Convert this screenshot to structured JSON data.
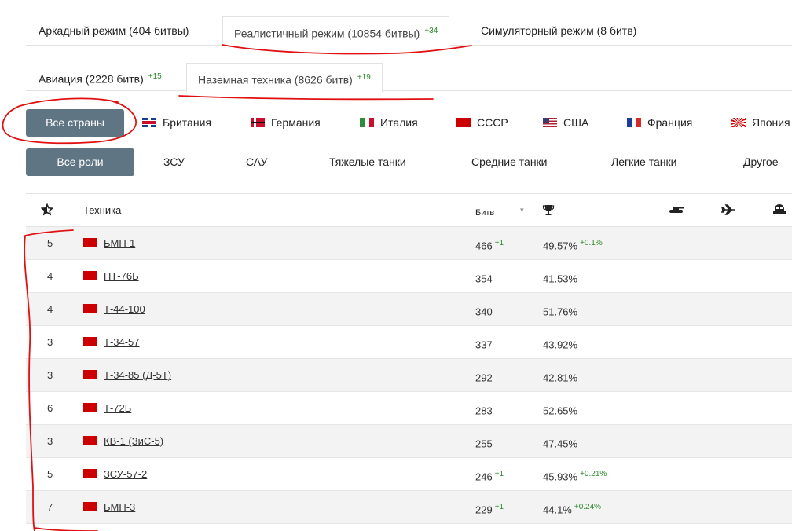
{
  "mode_tabs": [
    {
      "label": "Аркадный режим (404 битвы)",
      "delta": ""
    },
    {
      "label": "Реалистичный режим (10854 битвы)",
      "delta": "+34"
    },
    {
      "label": "Симуляторный режим (8 битв)",
      "delta": ""
    }
  ],
  "vehicle_tabs": [
    {
      "label": "Авиация (2228 битв)",
      "delta": "+15"
    },
    {
      "label": "Наземная техника (8626 битв)",
      "delta": "+19"
    }
  ],
  "country_filter": {
    "all_label": "Все страны",
    "countries": [
      "Британия",
      "Германия",
      "Италия",
      "СССР",
      "США",
      "Франция",
      "Япония"
    ]
  },
  "role_filter": {
    "all_label": "Все роли",
    "roles": [
      "ЗСУ",
      "САУ",
      "Тяжелые танки",
      "Средние танки",
      "Легкие танки",
      "Другое"
    ]
  },
  "table": {
    "col_vehicle": "Техника",
    "col_battles": "Битв",
    "rows": [
      {
        "rank": "5",
        "name": "БМП-1",
        "battles": "466",
        "battles_delta": "+1",
        "winrate": "49.57%",
        "winrate_delta": "+0.1%"
      },
      {
        "rank": "4",
        "name": "ПТ-76Б",
        "battles": "354",
        "battles_delta": "",
        "winrate": "41.53%",
        "winrate_delta": ""
      },
      {
        "rank": "4",
        "name": "Т-44-100",
        "battles": "340",
        "battles_delta": "",
        "winrate": "51.76%",
        "winrate_delta": ""
      },
      {
        "rank": "3",
        "name": "Т-34-57",
        "battles": "337",
        "battles_delta": "",
        "winrate": "43.92%",
        "winrate_delta": ""
      },
      {
        "rank": "3",
        "name": "Т-34-85 (Д-5Т)",
        "battles": "292",
        "battles_delta": "",
        "winrate": "42.81%",
        "winrate_delta": ""
      },
      {
        "rank": "6",
        "name": "Т-72Б",
        "battles": "283",
        "battles_delta": "",
        "winrate": "52.65%",
        "winrate_delta": ""
      },
      {
        "rank": "3",
        "name": "КВ-1 (ЗиС-5)",
        "battles": "255",
        "battles_delta": "",
        "winrate": "47.45%",
        "winrate_delta": ""
      },
      {
        "rank": "5",
        "name": "ЗСУ-57-2",
        "battles": "246",
        "battles_delta": "+1",
        "winrate": "45.93%",
        "winrate_delta": "+0.21%"
      },
      {
        "rank": "7",
        "name": "БМП-3",
        "battles": "229",
        "battles_delta": "+1",
        "winrate": "44.1%",
        "winrate_delta": "+0.24%"
      }
    ]
  },
  "colors": {
    "accent_button": "#607584",
    "positive_delta": "#2e8b2e",
    "annotation": "#e01010"
  }
}
